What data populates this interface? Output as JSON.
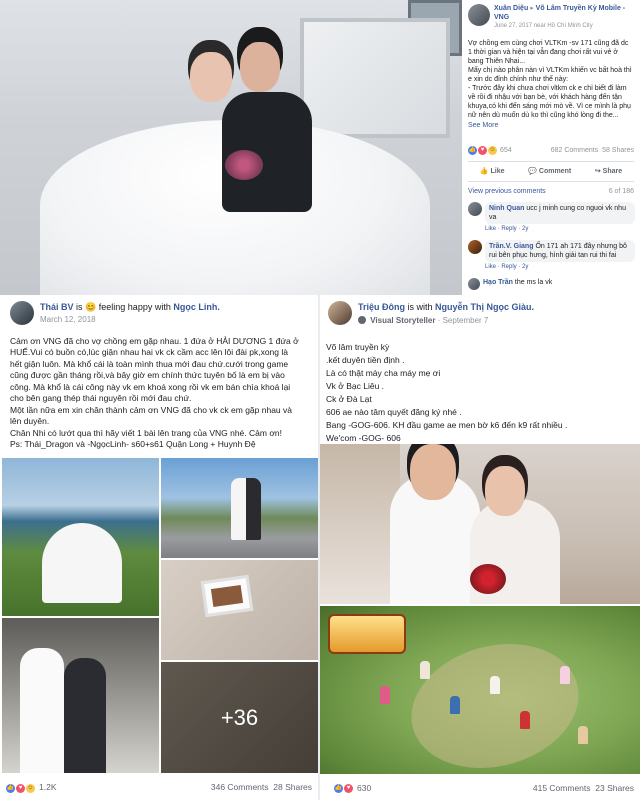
{
  "top_post": {
    "author": "Xuân Diệu",
    "page": "Võ Lâm Truyền Kỳ Mobile - VNG",
    "date": "June 27, 2017 near Hồ Chí Minh City",
    "body": [
      "Vợ chồng em cùng chơi VLTKm -sv 171 cũng đã dc",
      "1 thời gian và hiện tại vẫn đang chơi rất vui vẻ ở",
      "bang Thiên Nhai...",
      "Mấy chị nào phân nàn vì VLTKm khiến vc bất hoà thì",
      "e xin dc đính chính như thế này:",
      "- Trước đây khi chưa chơi vltkm ck e chỉ biết đi làm",
      "về rồi đi nhậu với bạn bè, với khách hàng đến tận",
      "khuya,có khi đến sáng mới mò về. Vì ce mình là phụ",
      "nữ nên dù muốn dù ko thì cũng khó lòng đi the..."
    ],
    "see_more": "See More",
    "reaction_count": "654",
    "comments": "682 Comments",
    "shares": "58 Shares",
    "actions": [
      "Like",
      "Comment",
      "Share"
    ],
    "view_previous": "View previous comments",
    "comment_page": "6 of 186",
    "comment_list": [
      {
        "name": "Ninh Quan",
        "text": "ucc j minh cung co nguoi vk nhu\nva",
        "meta": "Like · Reply · 2y"
      },
      {
        "name": "Trần.V. Giang",
        "text": "Ốn 171 ah 171 đây nhưng bô\nrui bên phục hưng, hình giải tan rui thi fai",
        "meta": "Like · Reply · 2y"
      },
      {
        "name": "Hạo Trần",
        "text": "the ms la vk",
        "meta": ""
      }
    ]
  },
  "left_post": {
    "author": "Thái BV",
    "status": "is",
    "feeling": "feeling happy with",
    "with": "Ngọc Linh.",
    "date": "March 12, 2018",
    "body": [
      "Cảm ơn VNG đã cho vợ chồng em gặp nhau. 1 đứa ở HẢI DƯƠNG 1 đứa ở",
      "HUẾ.Vui có buồn có,lúc giận nhau hai vk ck cầm acc lên lôi đài pk,xong là",
      "hết giận luôn. Mà khổ cái là toàn mình thua mới đau chứ.cưới trong game",
      "cũng được gần tháng rồi,và bây giờ em chính thức tuyên bố là em bị vào",
      "công. Mà khổ là cái công này vk em khoá xong rồi vk em bán chìa khoá lại",
      "cho bên gang thép thái nguyên rồi mới đau chứ.",
      "Một lần nữa em xin chân thành cảm ơn VNG đã cho vk ck em gặp nhau và",
      "lên duyên.",
      "Chân Nhi có lướt qua thì hãy viết 1 bài lên trang của VNG nhé. Cảm ơn!",
      "Ps: Thái_Dragon và -NgọcLinh- s60+s61 Quận Long + Huynh Đệ"
    ],
    "more_photos": "+36",
    "reaction_count": "1.2K",
    "comments": "346 Comments",
    "shares": "28 Shares"
  },
  "right_post": {
    "author": "Triệu Đông",
    "status": "is with",
    "with": "Nguyễn Thị Ngọc Giàu.",
    "badge": "Visual Storyteller",
    "date": "September 7",
    "body": [
      "Võ lâm truyền kỳ",
      ".kết duyên tiền định .",
      "Là có thật máy cha máy mẹ ơi",
      "Vk ở Bạc Liêu .",
      "Ck ở Đà Lạt",
      "606 ae nào tâm quyết đăng ký nhé .",
      "Bang -GOG-606. KH đầu game ae men bờ k6 đến k9 rất nhiều .",
      "We'com -GOG- 606"
    ],
    "reaction_count": "630",
    "comments": "415 Comments",
    "shares": "23 Shares"
  },
  "colors": {
    "link": "#385898",
    "muted": "#90949c",
    "like": "#4a7cf6",
    "love": "#f25268"
  }
}
